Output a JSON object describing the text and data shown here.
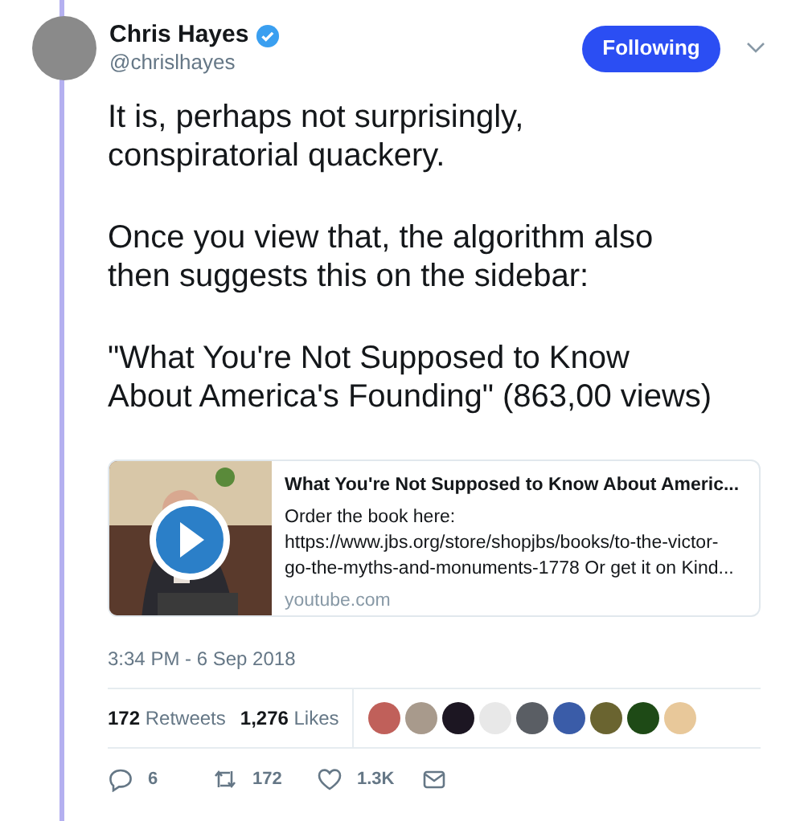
{
  "author": {
    "name": "Chris Hayes",
    "verified": true,
    "handle": "@chrislhayes"
  },
  "follow_button": {
    "label": "Following"
  },
  "paragraphs": [
    "It is, perhaps not surprisingly, conspiratorial quackery.",
    "Once you view that, the algorithm also then suggests this on the sidebar:",
    "\"What You're Not Supposed to Know About America's Founding\" (863,00 views)"
  ],
  "link_card": {
    "title": "What You're Not Supposed to Know About Americ...",
    "description": "Order the book here: https://www.jbs.org/store/shopjbs/books/to-the-victor-go-the-myths-and-monuments-1778 Or get it on Kind...",
    "domain": "youtube.com"
  },
  "timestamp": "3:34 PM - 6 Sep 2018",
  "stats": [
    {
      "count": "172",
      "label": "Retweets"
    },
    {
      "count": "1,276",
      "label": "Likes"
    }
  ],
  "liker_avatars": [
    {
      "color": "#c0605a"
    },
    {
      "color": "#a89a8c"
    },
    {
      "color": "#1c1622"
    },
    {
      "color": "#e8e8e8"
    },
    {
      "color": "#5a5e64"
    },
    {
      "color": "#3a5ca8"
    },
    {
      "color": "#6a6430"
    },
    {
      "color": "#1e4a16"
    },
    {
      "color": "#e8c89a"
    }
  ],
  "actions": [
    {
      "kind": "reply",
      "count": "6"
    },
    {
      "kind": "retweet",
      "count": "172"
    },
    {
      "kind": "like",
      "count": "1.3K"
    },
    {
      "kind": "message"
    }
  ]
}
